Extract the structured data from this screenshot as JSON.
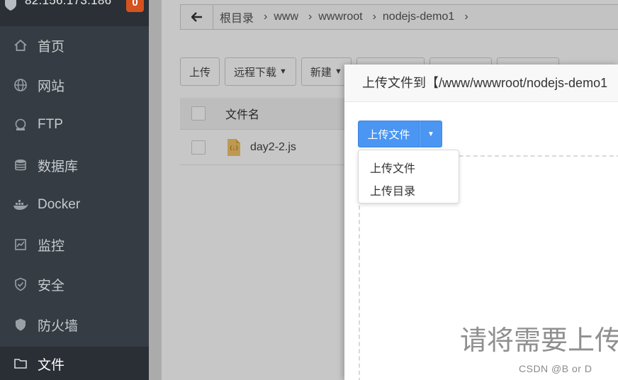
{
  "sidebar": {
    "host": "82.156.173.186",
    "badge": "0",
    "items": [
      {
        "label": "首页",
        "icon": "home-icon"
      },
      {
        "label": "网站",
        "icon": "globe-icon"
      },
      {
        "label": "FTP",
        "icon": "ftp-icon"
      },
      {
        "label": "数据库",
        "icon": "database-icon"
      },
      {
        "label": "Docker",
        "icon": "docker-icon"
      },
      {
        "label": "监控",
        "icon": "monitor-icon"
      },
      {
        "label": "安全",
        "icon": "shield-check-icon"
      },
      {
        "label": "防火墙",
        "icon": "firewall-icon"
      },
      {
        "label": "文件",
        "icon": "folder-icon"
      }
    ],
    "active": "文件"
  },
  "pathbar": {
    "crumbs": [
      "根目录",
      "www",
      "wwwroot",
      "nodejs-demo1"
    ]
  },
  "toolbar": {
    "upload": "上传",
    "remote_download": "远程下载",
    "new": "新建"
  },
  "table": {
    "col_name": "文件名",
    "rows": [
      {
        "name": "day2-2.js"
      }
    ]
  },
  "modal": {
    "title": "上传文件到【/www/wwwroot/nodejs-demo1",
    "upload_button": "上传文件",
    "dropdown": [
      "上传文件",
      "上传目录"
    ],
    "drop_hint": "请将需要上传"
  },
  "watermark": "CSDN @B    or    D",
  "colors": {
    "sidebar_bg": "#353c43",
    "badge": "#d6521f",
    "primary": "#4a96f2"
  }
}
